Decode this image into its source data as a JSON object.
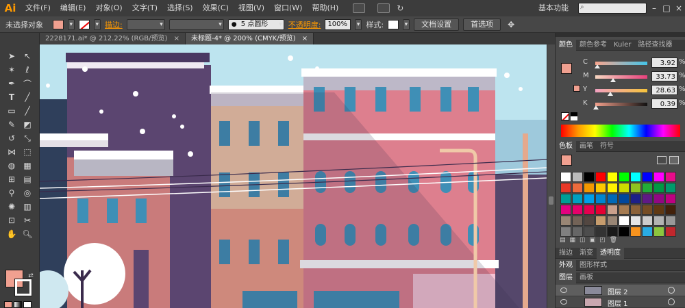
{
  "app": {
    "logo": "Ai"
  },
  "menubar": {
    "items": [
      "文件(F)",
      "编辑(E)",
      "对象(O)",
      "文字(T)",
      "选择(S)",
      "效果(C)",
      "视图(V)",
      "窗口(W)",
      "帮助(H)"
    ],
    "workspace": "基本功能",
    "window_controls": [
      "–",
      "□",
      "×"
    ]
  },
  "controlbar": {
    "selection_state": "未选择对象",
    "stroke_label": "描边:",
    "brush_value": "5 点圆形",
    "opacity_label": "不透明度:",
    "opacity_value": "100%",
    "style_label": "样式:",
    "doc_setup": "文档设置",
    "preferences": "首选项",
    "fill_color": "#f0a090"
  },
  "doctabs": [
    {
      "label": "2228171.ai* @ 212.22% (RGB/预览)",
      "close": "×"
    },
    {
      "label": "未标题-4* @ 200% (CMYK/预览)",
      "close": "×"
    }
  ],
  "color_panel": {
    "tabs": [
      "颜色",
      "颜色参考",
      "Kuler",
      "路径查找器"
    ],
    "sliders": [
      {
        "letter": "C",
        "value": "3.92",
        "unit": "%",
        "fraction": 0.04,
        "gradient": "linear-gradient(90deg,#f9a58d,#44c4e8)"
      },
      {
        "letter": "M",
        "value": "33.73",
        "unit": "%",
        "fraction": 0.34,
        "gradient": "linear-gradient(90deg,#f6d6c0,#e8407c)"
      },
      {
        "letter": "Y",
        "value": "28.63",
        "unit": "%",
        "fraction": 0.29,
        "gradient": "linear-gradient(90deg,#f3a1c2,#f5c33a)"
      },
      {
        "letter": "K",
        "value": "0.39",
        "unit": "%",
        "fraction": 0.01,
        "gradient": "linear-gradient(90deg,#f3a08c,#111111)"
      }
    ]
  },
  "swatches_panel": {
    "tabs": [
      "色板",
      "画笔",
      "符号"
    ],
    "colors": [
      "#ffffff",
      "#bbbbbb",
      "#000000",
      "#ff0000",
      "#ffff00",
      "#00ff00",
      "#00ffff",
      "#0000ff",
      "#ff00ff",
      "#e70b8a",
      "#e83828",
      "#ec6b3c",
      "#f39800",
      "#fcc800",
      "#fff100",
      "#cfdb00",
      "#8fc31f",
      "#22ac38",
      "#009944",
      "#009b6b",
      "#009e96",
      "#00a0c1",
      "#00a0e9",
      "#0086d1",
      "#0068b7",
      "#00479d",
      "#1d2088",
      "#601986",
      "#920783",
      "#be0081",
      "#e4007f",
      "#e5006a",
      "#e5004f",
      "#e60033",
      "#c9a08c",
      "#a67c52",
      "#8c6239",
      "#754c24",
      "#603913",
      "#42210b",
      "#998675",
      "#736357",
      "#534741",
      "#c69c6d",
      "#998675",
      "#ffffff",
      "#e6e6e6",
      "#cccccc",
      "#b3b3b3",
      "#999999",
      "#808080",
      "#666666",
      "#4d4d4d",
      "#333333",
      "#1a1a1a",
      "#000000",
      "#f7931e",
      "#29abe2",
      "#8cc63f",
      "#c1272d"
    ]
  },
  "bottom_tabs": {
    "row1": [
      "描边",
      "渐变",
      "透明度"
    ],
    "row2": [
      "外观",
      "图形样式"
    ],
    "row3": [
      "图层",
      "画板"
    ]
  },
  "layers": [
    {
      "name": "图层 2"
    },
    {
      "name": "图层 1"
    }
  ]
}
